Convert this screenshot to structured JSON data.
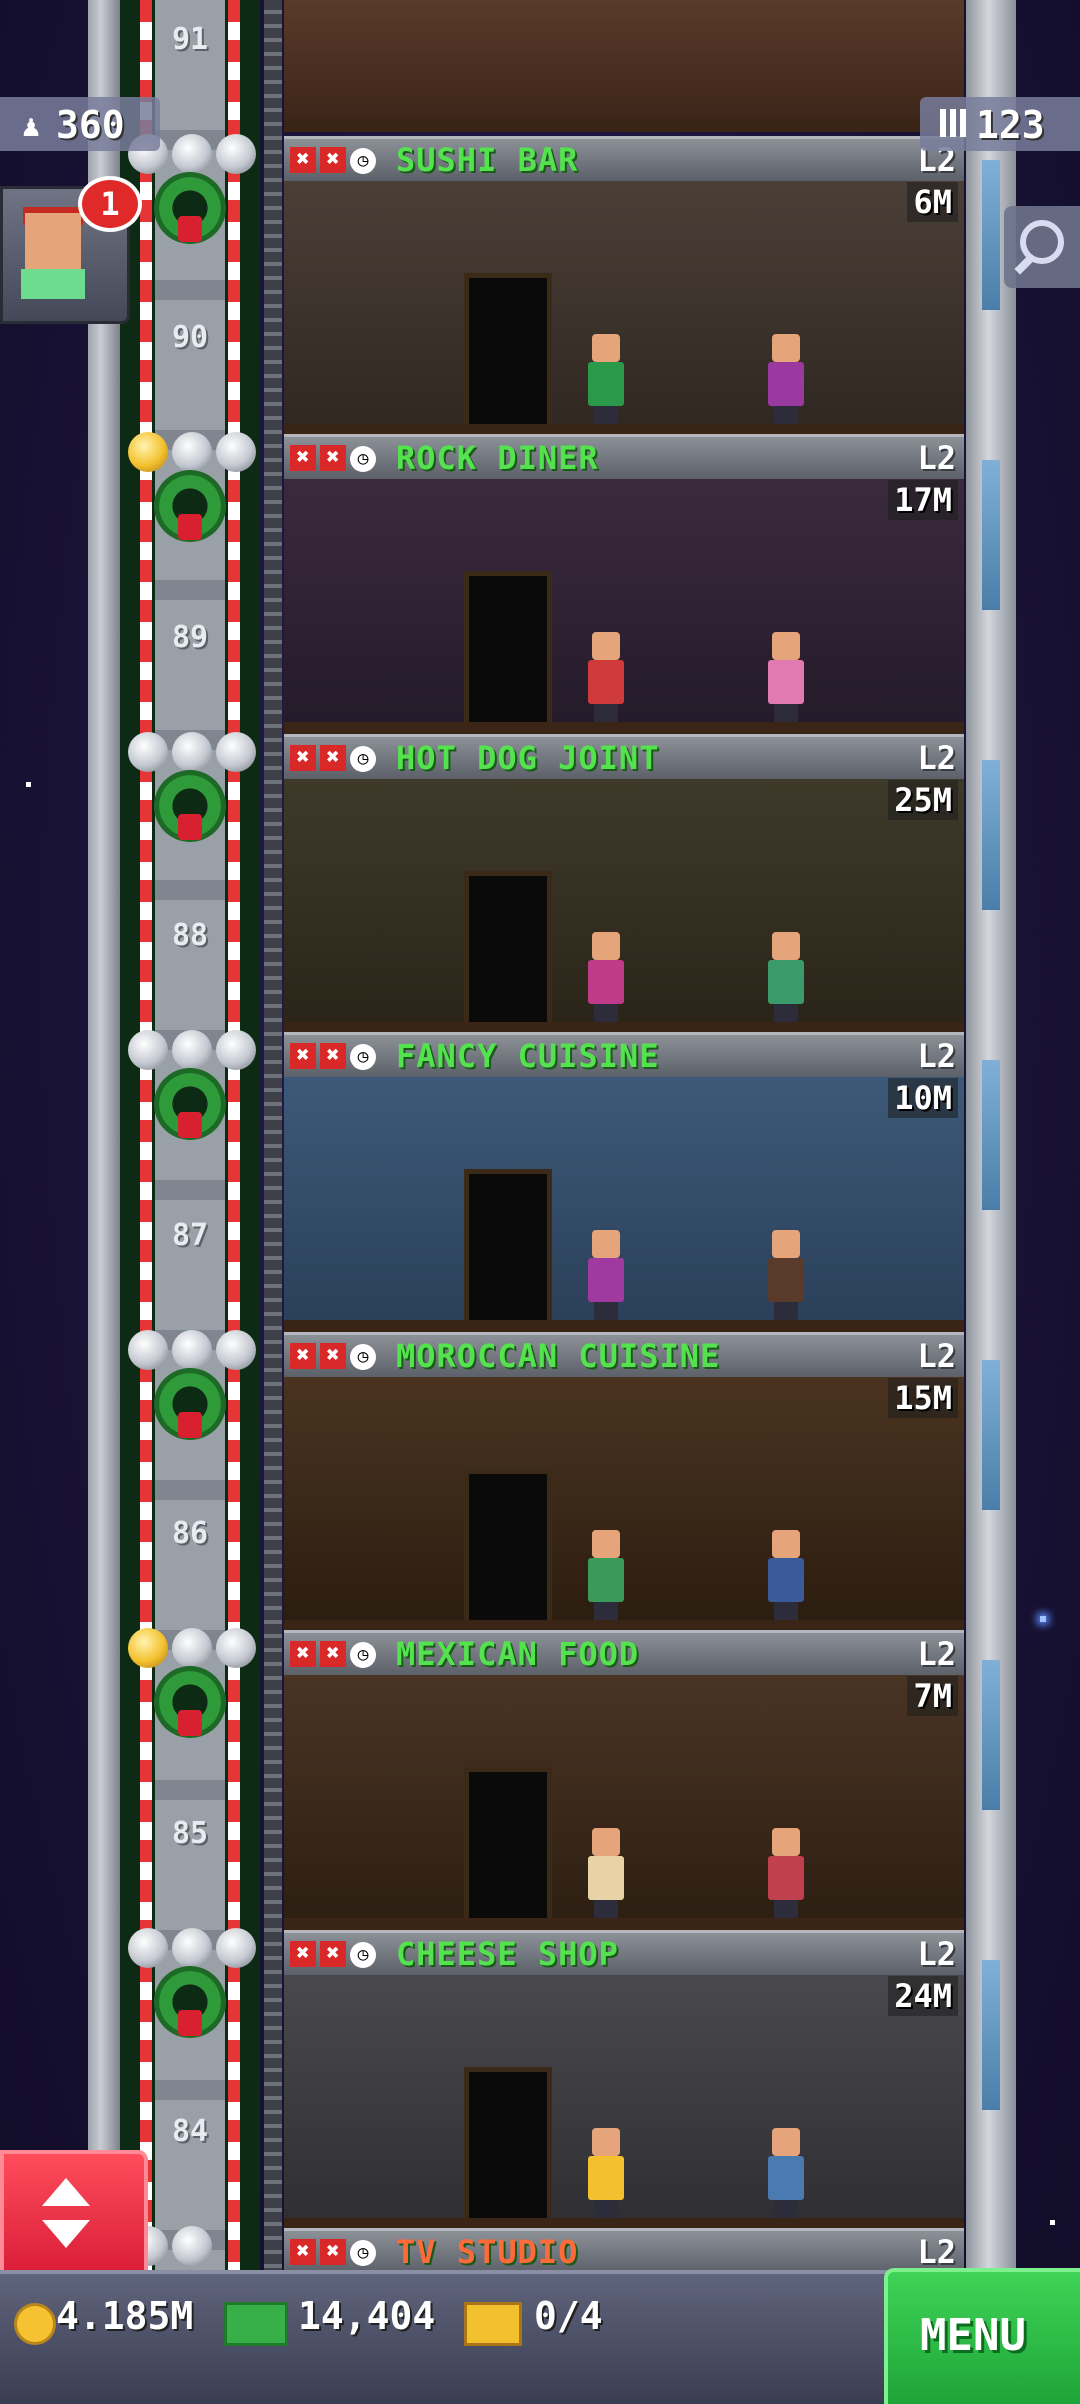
{
  "hud": {
    "population": "360",
    "floor_count": "123",
    "notification_count": "1",
    "coins": "4.185M",
    "tower_bux": "14,404",
    "tickets": "0/4",
    "menu_label": "MENU"
  },
  "floor_numbers": [
    "91",
    "90",
    "89",
    "88",
    "87",
    "86",
    "85",
    "84"
  ],
  "floors": [
    {
      "name": "SUSHI BAR",
      "level": "L2",
      "timer": "6M",
      "stars": [
        "silver",
        "silver",
        "silver"
      ]
    },
    {
      "name": "ROCK DINER",
      "level": "L2",
      "timer": "17M",
      "stars": [
        "gold",
        "silver",
        "silver"
      ]
    },
    {
      "name": "HOT DOG JOINT",
      "level": "L2",
      "timer": "25M",
      "stars": [
        "silver",
        "silver",
        "silver"
      ]
    },
    {
      "name": "FANCY CUISINE",
      "level": "L2",
      "timer": "10M",
      "stars": [
        "silver",
        "silver",
        "silver"
      ]
    },
    {
      "name": "MOROCCAN CUISINE",
      "level": "L2",
      "timer": "15M",
      "stars": [
        "silver",
        "silver",
        "silver"
      ]
    },
    {
      "name": "MEXICAN FOOD",
      "level": "L2",
      "timer": "7M",
      "stars": [
        "gold",
        "silver",
        "silver"
      ]
    },
    {
      "name": "CHEESE SHOP",
      "level": "L2",
      "timer": "24M",
      "stars": [
        "silver",
        "silver",
        "silver"
      ]
    },
    {
      "name": "TV STUDIO",
      "level": "L2",
      "timer": "",
      "stars": [
        "silver",
        "silver"
      ]
    }
  ],
  "icons": {
    "status": [
      "x-icon",
      "x-icon",
      "clock-icon"
    ],
    "population": "person-icon",
    "floors": "building-icon",
    "search": "magnifier-icon",
    "coins": "coin-icon",
    "bux": "bux-icon",
    "tickets": "ticket-icon",
    "elevator": "up-down-arrow-icon"
  },
  "colors": {
    "room_name": "#54e34f",
    "menu_button": "#2fbd47",
    "elevator_button": "#e8283c",
    "notify_badge": "#e02a2a"
  }
}
